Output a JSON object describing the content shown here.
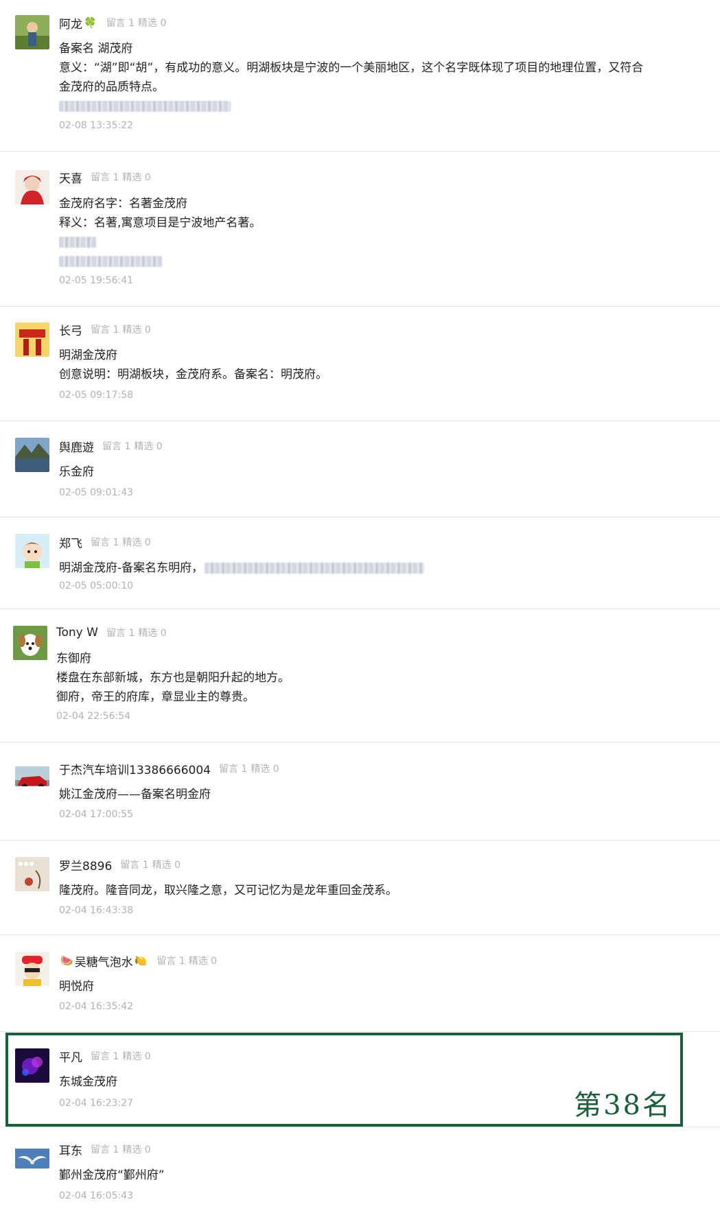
{
  "comments": [
    {
      "nickname": "阿龙",
      "nick_suffix": "🍀",
      "reply_label": "留言 1",
      "featured_label": "精选 0",
      "lines": [
        "备案名 湖茂府",
        "意义：“湖”即“胡”，有成功的意义。明湖板块是宁波的一个美丽地区，这个名字既体现了项目的地理位置，又符合",
        "金茂府的品质特点。"
      ],
      "timestamp": "02-08 13:35:22",
      "avatar_icon": "landscape-avatar-icon"
    },
    {
      "nickname": "天喜",
      "reply_label": "留言 1",
      "featured_label": "精选 0",
      "lines": [
        "金茂府名字：名著金茂府",
        "释义：名著,寓意项目是宁波地产名著。"
      ],
      "timestamp": "02-05 19:56:41",
      "avatar_icon": "red-scarf-avatar-icon"
    },
    {
      "nickname": "长弓",
      "reply_label": "留言 1",
      "featured_label": "精选 0",
      "lines": [
        "明湖金茂府",
        "创意说明：明湖板块，金茂府系。备案名：明茂府。"
      ],
      "timestamp": "02-05 09:17:58",
      "avatar_icon": "red-poster-avatar-icon"
    },
    {
      "nickname": "舆鹿遊",
      "reply_label": "留言 1",
      "featured_label": "精选 0",
      "lines": [
        "乐金府"
      ],
      "timestamp": "02-05 09:01:43",
      "avatar_icon": "lake-avatar-icon"
    },
    {
      "nickname": "郑飞",
      "reply_label": "留言 1",
      "featured_label": "精选 0",
      "lines": [
        "明湖金茂府-备案名东明府，"
      ],
      "timestamp": "02-05 05:00:10",
      "avatar_icon": "cartoon-boy-avatar-icon"
    },
    {
      "nickname": "Tony W",
      "reply_label": "留言 1",
      "featured_label": "精选 0",
      "lines": [
        "东御府",
        "楼盘在东部新城，东方也是朝阳升起的地方。",
        "御府，帝王的府库，章显业主的尊贵。"
      ],
      "timestamp": "02-04 22:56:54",
      "avatar_icon": "dog-avatar-icon"
    },
    {
      "nickname": "于杰汽车培训13386666004",
      "reply_label": "留言 1",
      "featured_label": "精选 0",
      "lines": [
        "姚江金茂府——备案名明金府"
      ],
      "timestamp": "02-04 17:00:55",
      "avatar_icon": "red-car-avatar-icon"
    },
    {
      "nickname": "罗兰8896",
      "reply_label": "留言 1",
      "featured_label": "精选 0",
      "lines": [
        "隆茂府。隆音同龙，取兴隆之意，又可记忆为是龙年重回金茂系。"
      ],
      "timestamp": "02-04 16:43:38",
      "avatar_icon": "painting-avatar-icon"
    },
    {
      "nickname": "吴糖气泡水",
      "nick_prefix": "🍉",
      "nick_suffix": "🍋",
      "reply_label": "留言 1",
      "featured_label": "精选 0",
      "lines": [
        "明悦府"
      ],
      "timestamp": "02-04 16:35:42",
      "avatar_icon": "cartoon-girl-avatar-icon"
    },
    {
      "nickname": "平凡",
      "reply_label": "留言 1",
      "featured_label": "精选 0",
      "lines": [
        "东城金茂府"
      ],
      "timestamp": "02-04 16:23:27",
      "avatar_icon": "purple-light-avatar-icon"
    },
    {
      "nickname": "耳东",
      "reply_label": "留言 1",
      "featured_label": "精选 0",
      "lines": [
        "鄞州金茂府“鄞州府”"
      ],
      "timestamp": "02-04 16:05:43",
      "avatar_icon": "seagull-avatar-icon"
    }
  ],
  "highlight": {
    "label": "第38名",
    "color": "#1b5e3b"
  },
  "colors": {
    "text": "#222222",
    "muted": "#b2b2b2",
    "divider": "#e6e6e6"
  }
}
